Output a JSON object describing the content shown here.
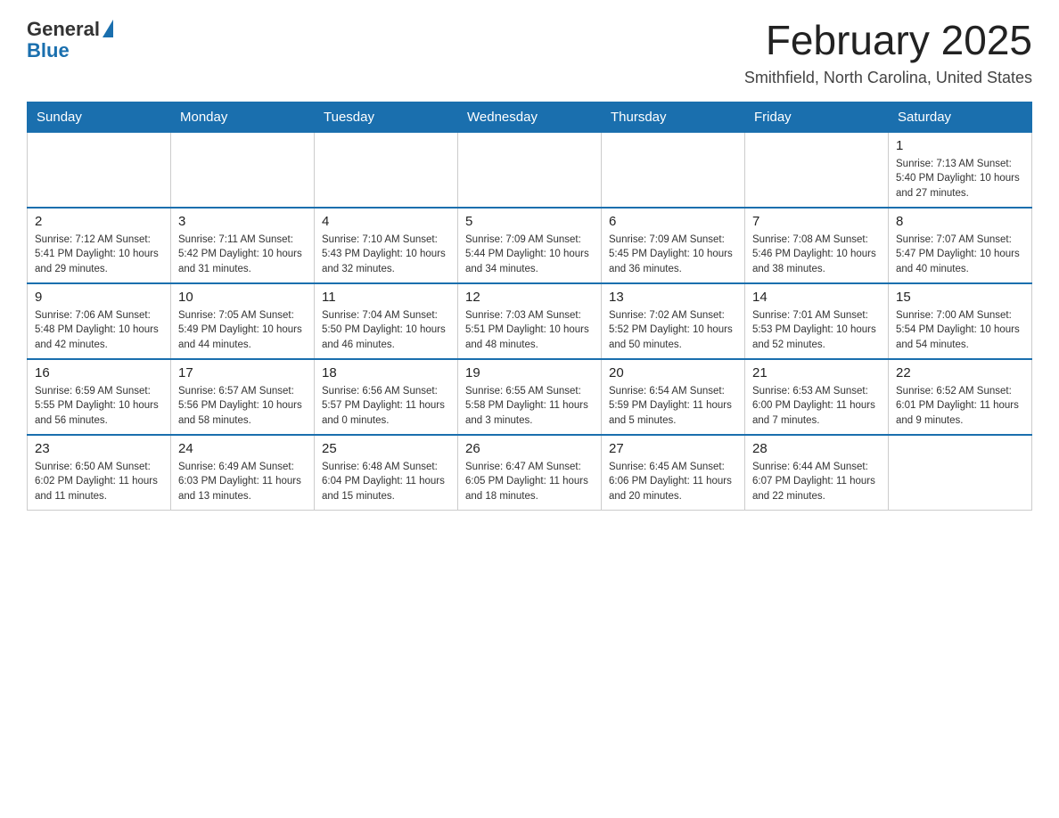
{
  "header": {
    "logo_general": "General",
    "logo_blue": "Blue",
    "title": "February 2025",
    "subtitle": "Smithfield, North Carolina, United States"
  },
  "days_of_week": [
    "Sunday",
    "Monday",
    "Tuesday",
    "Wednesday",
    "Thursday",
    "Friday",
    "Saturday"
  ],
  "weeks": [
    [
      {
        "day": "",
        "info": ""
      },
      {
        "day": "",
        "info": ""
      },
      {
        "day": "",
        "info": ""
      },
      {
        "day": "",
        "info": ""
      },
      {
        "day": "",
        "info": ""
      },
      {
        "day": "",
        "info": ""
      },
      {
        "day": "1",
        "info": "Sunrise: 7:13 AM\nSunset: 5:40 PM\nDaylight: 10 hours\nand 27 minutes."
      }
    ],
    [
      {
        "day": "2",
        "info": "Sunrise: 7:12 AM\nSunset: 5:41 PM\nDaylight: 10 hours\nand 29 minutes."
      },
      {
        "day": "3",
        "info": "Sunrise: 7:11 AM\nSunset: 5:42 PM\nDaylight: 10 hours\nand 31 minutes."
      },
      {
        "day": "4",
        "info": "Sunrise: 7:10 AM\nSunset: 5:43 PM\nDaylight: 10 hours\nand 32 minutes."
      },
      {
        "day": "5",
        "info": "Sunrise: 7:09 AM\nSunset: 5:44 PM\nDaylight: 10 hours\nand 34 minutes."
      },
      {
        "day": "6",
        "info": "Sunrise: 7:09 AM\nSunset: 5:45 PM\nDaylight: 10 hours\nand 36 minutes."
      },
      {
        "day": "7",
        "info": "Sunrise: 7:08 AM\nSunset: 5:46 PM\nDaylight: 10 hours\nand 38 minutes."
      },
      {
        "day": "8",
        "info": "Sunrise: 7:07 AM\nSunset: 5:47 PM\nDaylight: 10 hours\nand 40 minutes."
      }
    ],
    [
      {
        "day": "9",
        "info": "Sunrise: 7:06 AM\nSunset: 5:48 PM\nDaylight: 10 hours\nand 42 minutes."
      },
      {
        "day": "10",
        "info": "Sunrise: 7:05 AM\nSunset: 5:49 PM\nDaylight: 10 hours\nand 44 minutes."
      },
      {
        "day": "11",
        "info": "Sunrise: 7:04 AM\nSunset: 5:50 PM\nDaylight: 10 hours\nand 46 minutes."
      },
      {
        "day": "12",
        "info": "Sunrise: 7:03 AM\nSunset: 5:51 PM\nDaylight: 10 hours\nand 48 minutes."
      },
      {
        "day": "13",
        "info": "Sunrise: 7:02 AM\nSunset: 5:52 PM\nDaylight: 10 hours\nand 50 minutes."
      },
      {
        "day": "14",
        "info": "Sunrise: 7:01 AM\nSunset: 5:53 PM\nDaylight: 10 hours\nand 52 minutes."
      },
      {
        "day": "15",
        "info": "Sunrise: 7:00 AM\nSunset: 5:54 PM\nDaylight: 10 hours\nand 54 minutes."
      }
    ],
    [
      {
        "day": "16",
        "info": "Sunrise: 6:59 AM\nSunset: 5:55 PM\nDaylight: 10 hours\nand 56 minutes."
      },
      {
        "day": "17",
        "info": "Sunrise: 6:57 AM\nSunset: 5:56 PM\nDaylight: 10 hours\nand 58 minutes."
      },
      {
        "day": "18",
        "info": "Sunrise: 6:56 AM\nSunset: 5:57 PM\nDaylight: 11 hours\nand 0 minutes."
      },
      {
        "day": "19",
        "info": "Sunrise: 6:55 AM\nSunset: 5:58 PM\nDaylight: 11 hours\nand 3 minutes."
      },
      {
        "day": "20",
        "info": "Sunrise: 6:54 AM\nSunset: 5:59 PM\nDaylight: 11 hours\nand 5 minutes."
      },
      {
        "day": "21",
        "info": "Sunrise: 6:53 AM\nSunset: 6:00 PM\nDaylight: 11 hours\nand 7 minutes."
      },
      {
        "day": "22",
        "info": "Sunrise: 6:52 AM\nSunset: 6:01 PM\nDaylight: 11 hours\nand 9 minutes."
      }
    ],
    [
      {
        "day": "23",
        "info": "Sunrise: 6:50 AM\nSunset: 6:02 PM\nDaylight: 11 hours\nand 11 minutes."
      },
      {
        "day": "24",
        "info": "Sunrise: 6:49 AM\nSunset: 6:03 PM\nDaylight: 11 hours\nand 13 minutes."
      },
      {
        "day": "25",
        "info": "Sunrise: 6:48 AM\nSunset: 6:04 PM\nDaylight: 11 hours\nand 15 minutes."
      },
      {
        "day": "26",
        "info": "Sunrise: 6:47 AM\nSunset: 6:05 PM\nDaylight: 11 hours\nand 18 minutes."
      },
      {
        "day": "27",
        "info": "Sunrise: 6:45 AM\nSunset: 6:06 PM\nDaylight: 11 hours\nand 20 minutes."
      },
      {
        "day": "28",
        "info": "Sunrise: 6:44 AM\nSunset: 6:07 PM\nDaylight: 11 hours\nand 22 minutes."
      },
      {
        "day": "",
        "info": ""
      }
    ]
  ]
}
